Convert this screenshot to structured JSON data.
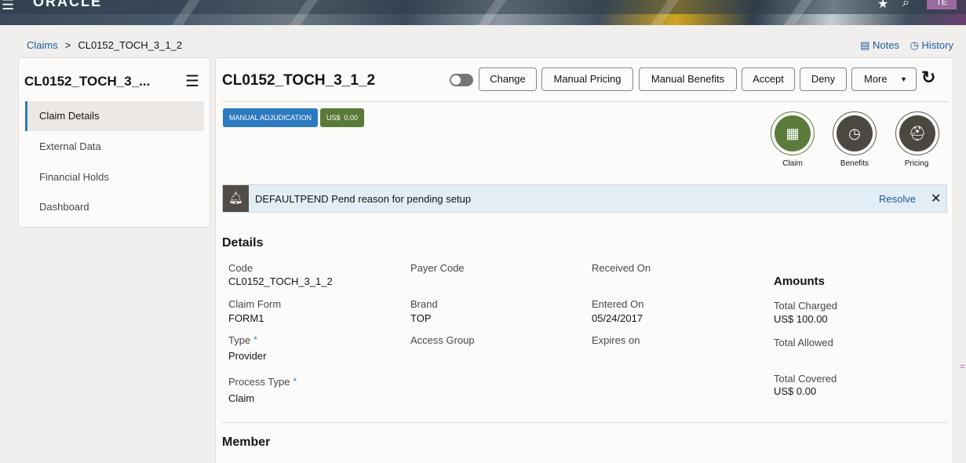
{
  "header": {
    "logo": "ORACLE",
    "avatar_initials": "TE"
  },
  "breadcrumb": {
    "root": "Claims",
    "separator": ">",
    "current": "CL0152_TOCH_3_1_2"
  },
  "top_links": {
    "notes": "Notes",
    "history": "History"
  },
  "sidebar": {
    "title": "CL0152_TOCH_3_...",
    "items": [
      {
        "label": "Claim Details",
        "active": true
      },
      {
        "label": "External Data"
      },
      {
        "label": "Financial Holds"
      },
      {
        "label": "Dashboard"
      }
    ]
  },
  "claim": {
    "title": "CL0152_TOCH_3_1_2",
    "buttons": {
      "change": "Change",
      "manual_pricing": "Manual Pricing",
      "manual_benefits": "Manual Benefits",
      "accept": "Accept",
      "deny": "Deny",
      "more": "More"
    },
    "badges": {
      "status": "MANUAL ADJUDICATION",
      "currency": "US$",
      "amount": "0.00"
    },
    "shortcuts": [
      {
        "label": "Claim",
        "icon": "table-icon"
      },
      {
        "label": "Benefits",
        "icon": "clock-icon"
      },
      {
        "label": "Pricing",
        "icon": "user-badge-icon"
      }
    ]
  },
  "alert": {
    "text": "DEFAULTPEND Pend reason for pending setup",
    "action": "Resolve"
  },
  "details": {
    "title": "Details",
    "code_label": "Code",
    "code_value": "CL0152_TOCH_3_1_2",
    "claim_form_label": "Claim Form",
    "claim_form_value": "FORM1",
    "type_label": "Type",
    "type_value": "Provider",
    "process_type_label": "Process Type",
    "process_type_value": "Claim",
    "payer_code_label": "Payer Code",
    "brand_label": "Brand",
    "brand_value": "TOP",
    "access_group_label": "Access Group",
    "received_on_label": "Received On",
    "entered_on_label": "Entered On",
    "entered_on_value": "05/24/2017",
    "expires_on_label": "Expires on",
    "required_mark": "*"
  },
  "amounts": {
    "title": "Amounts",
    "total_charged_label": "Total Charged",
    "total_charged_value": "US$  100.00",
    "total_allowed_label": "Total Allowed",
    "total_covered_label": "Total Covered",
    "total_covered_value": "US$  0.00"
  },
  "member": {
    "title": "Member"
  }
}
